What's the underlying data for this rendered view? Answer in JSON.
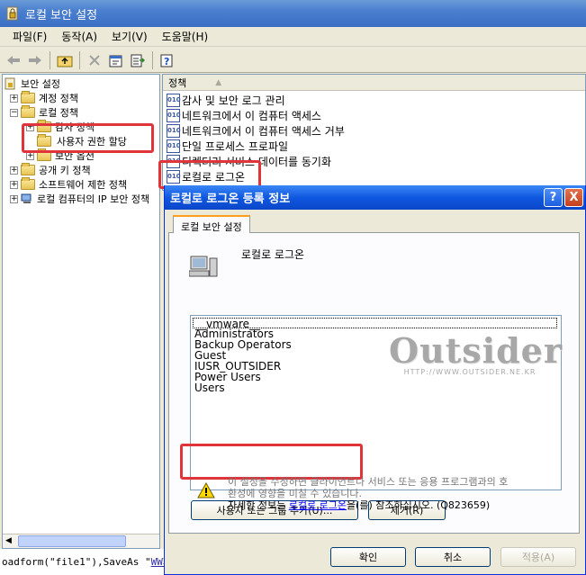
{
  "window": {
    "title": "로컬 보안 설정"
  },
  "menu": [
    "파일(F)",
    "동작(A)",
    "보기(V)",
    "도움말(H)"
  ],
  "tree": {
    "items": [
      {
        "label": "보안 설정"
      },
      {
        "label": "계정 정책"
      },
      {
        "label": "로컬 정책"
      },
      {
        "label": "감사 정책"
      },
      {
        "label": "사용자 권한 할당"
      },
      {
        "label": "보안 옵션"
      },
      {
        "label": "공개 키 정책"
      },
      {
        "label": "소프트웨어 제한 정책"
      },
      {
        "label": "로컬 컴퓨터의 IP 보안 정책"
      }
    ]
  },
  "policy_list": {
    "column": "정책",
    "rows": [
      "감사 및 보안 로그 관리",
      "네트워크에서 이 컴퓨터 액세스",
      "네트워크에서 이 컴퓨터 액세스 거부",
      "단일 프로세스 프로파일",
      "디렉터리 서비스 데이터를 동기화",
      "로컬로 로그온"
    ]
  },
  "status_line": {
    "prefix": "oadform(\"file1\"),SaveAs \"",
    "link": "WW파일"
  },
  "dialog": {
    "title": "로컬로 로그온 등록 정보",
    "help": "?",
    "close": "X",
    "tab": "로컬 보안 설정",
    "policy_name": "로컬로 로그온",
    "members": [
      "__vmware__",
      "Administrators",
      "Backup Operators",
      "Guest",
      "IUSR_OUTSIDER",
      "Power Users",
      "Users"
    ],
    "add_button": "사용자 또는 그룹 추가(U)...",
    "remove_button": "제거(R)",
    "warning": {
      "line1": "이 설정을 수정하면 클라이언트나 서비스 또는 응용 프로그램과의 호",
      "line2": "환성에 영향을 미칠 수 있습니다.",
      "line3_prefix": "자세한 정보는 ",
      "link": "로컬로 로그온",
      "line3_suffix": "을(를) 참조하십시오. (Q823659)"
    },
    "ok": "확인",
    "cancel": "취소",
    "apply": "적용(A)"
  },
  "watermark": {
    "brand": "Outsider",
    "url": "HTTP://WWW.OUTSIDER.NE.KR"
  },
  "colors": {
    "highlight": "#e0333a",
    "xp_title": "#0f58e0"
  }
}
